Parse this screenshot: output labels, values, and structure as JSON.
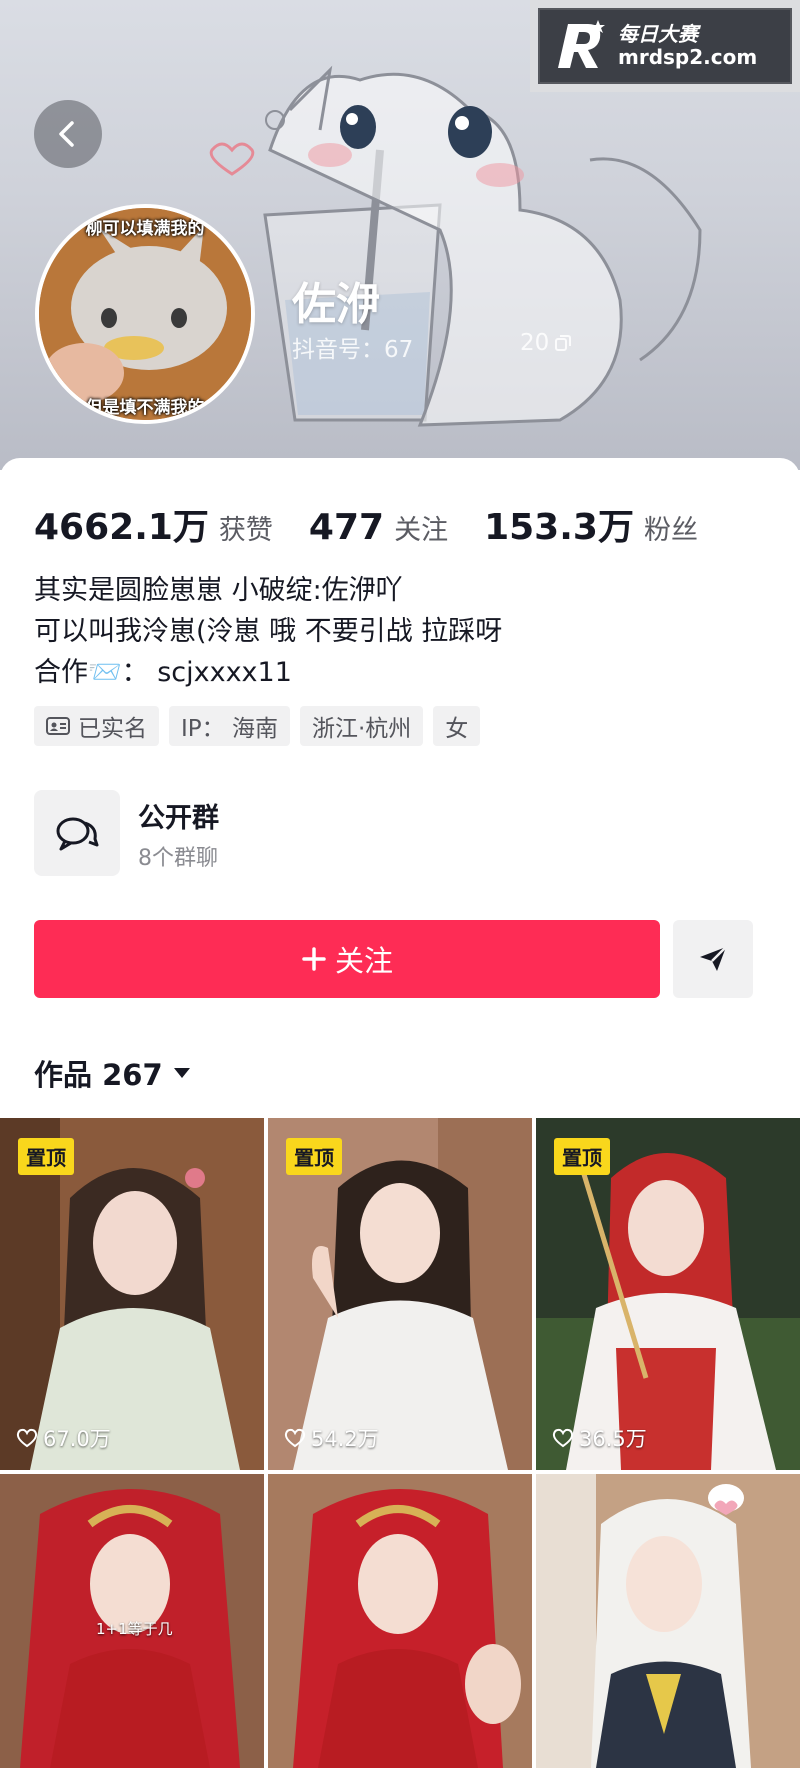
{
  "watermark": {
    "brand_cn": "每日大赛",
    "brand_url": "mrdsp2.com"
  },
  "profile": {
    "avatar_caption_top": "柳可以填满我的",
    "avatar_caption_bottom": "但是填不满我的",
    "name": "佐洢",
    "douyin_id": "抖音号：67",
    "id_extra": "20"
  },
  "stats": [
    {
      "value": "4662.1万",
      "label": "获赞"
    },
    {
      "value": "477",
      "label": "关注"
    },
    {
      "value": "153.3万",
      "label": "粉丝"
    }
  ],
  "bio": {
    "line1": "其实是圆脸崽崽 小破绽:佐洢吖",
    "line2": "可以叫我泠崽(泠崽 哦  不要引战 拉踩呀",
    "line3": "合作📨：  scjxxxx11"
  },
  "tags": {
    "verified": "已实名",
    "ip": "IP：  海南",
    "location": "浙江·杭州",
    "gender": "女"
  },
  "group": {
    "title": "公开群",
    "subtitle": "8个群聊"
  },
  "actions": {
    "follow": "关注"
  },
  "works_tab": {
    "label": "作品 267"
  },
  "videos": [
    {
      "pinned": "置顶",
      "likes": "67.0万"
    },
    {
      "pinned": "置顶",
      "likes": "54.2万"
    },
    {
      "pinned": "置顶",
      "likes": "36.5万"
    },
    {
      "caption": "1+1等于几"
    }
  ],
  "colors": {
    "accent": "#fe2c55",
    "pin": "#f9d71c"
  }
}
